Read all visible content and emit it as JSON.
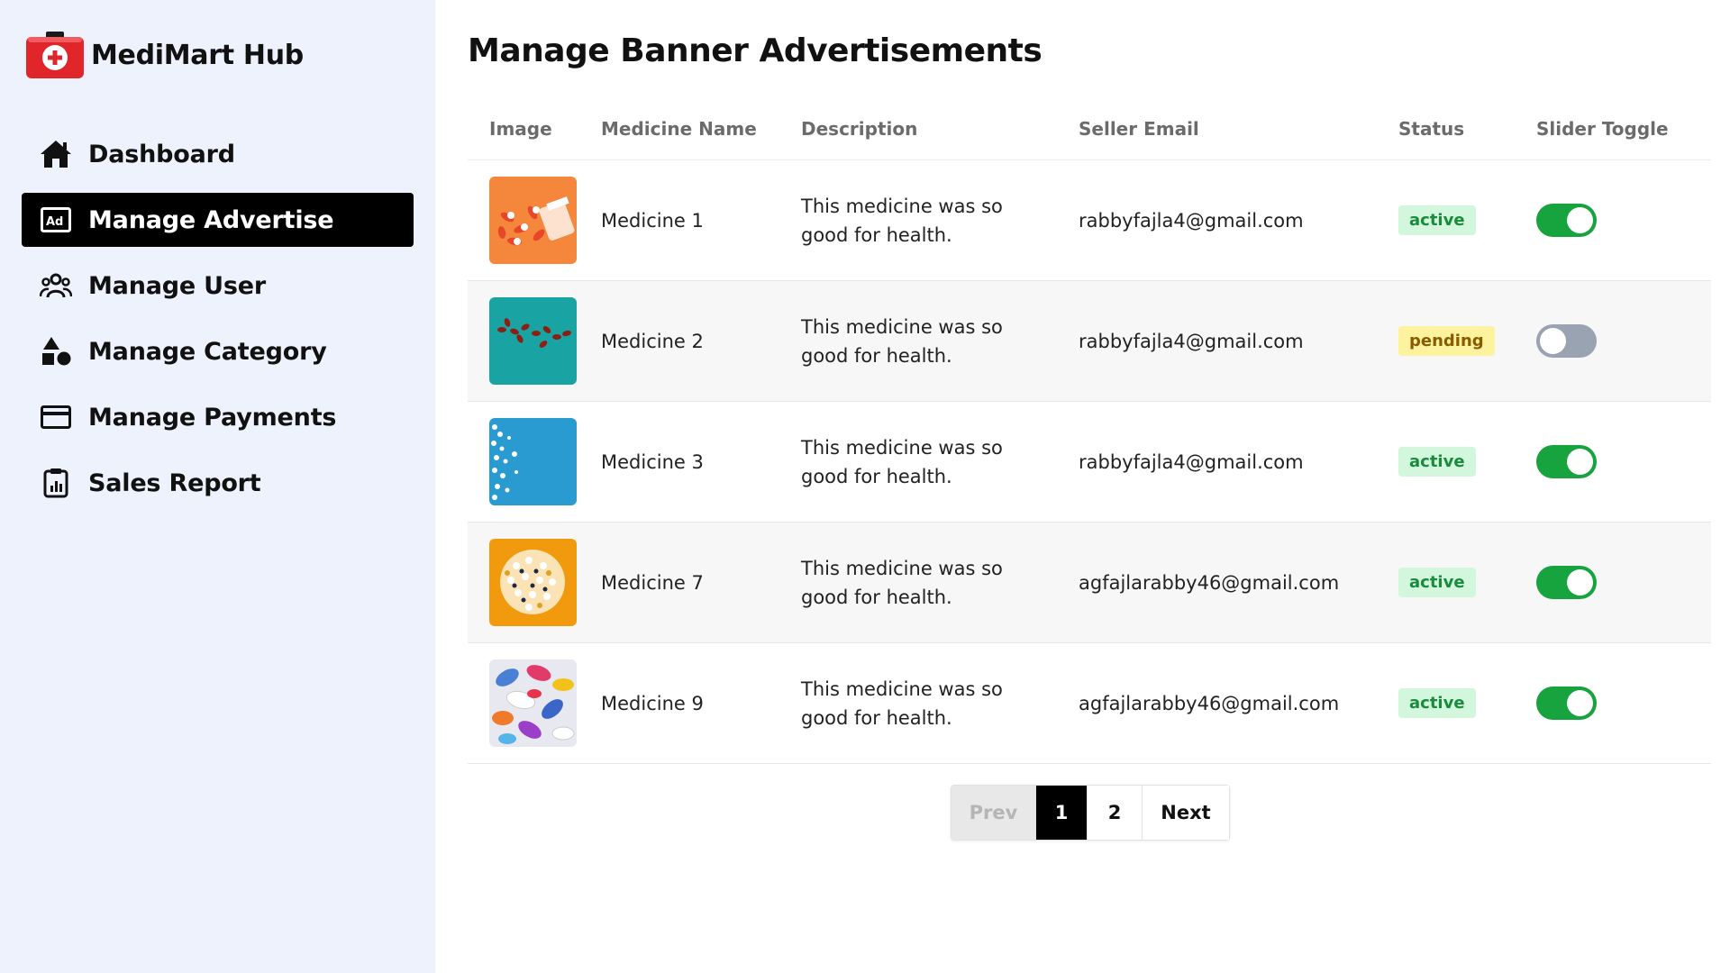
{
  "app": {
    "name": "MediMart Hub"
  },
  "sidebar": {
    "items": [
      {
        "label": "Dashboard",
        "icon": "home-icon"
      },
      {
        "label": "Manage Advertise",
        "icon": "ad-icon",
        "active": true
      },
      {
        "label": "Manage User",
        "icon": "users-icon"
      },
      {
        "label": "Manage Category",
        "icon": "shapes-icon"
      },
      {
        "label": "Manage Payments",
        "icon": "credit-card-icon"
      },
      {
        "label": "Sales Report",
        "icon": "clipboard-report-icon"
      }
    ]
  },
  "page": {
    "title": "Manage Banner Advertisements"
  },
  "table": {
    "headers": {
      "image": "Image",
      "name": "Medicine Name",
      "description": "Description",
      "email": "Seller Email",
      "status": "Status",
      "toggle": "Slider Toggle"
    },
    "rows": [
      {
        "name": "Medicine 1",
        "description": "This medicine was so good for health.",
        "email": "rabbyfajla4@gmail.com",
        "status": "active",
        "slider_on": true,
        "image": "orange-pills-bottle"
      },
      {
        "name": "Medicine 2",
        "description": "This medicine was so good for health.",
        "email": "rabbyfajla4@gmail.com",
        "status": "pending",
        "slider_on": false,
        "image": "teal-red-capsules"
      },
      {
        "name": "Medicine 3",
        "description": "This medicine was so good for health.",
        "email": "rabbyfajla4@gmail.com",
        "status": "active",
        "slider_on": true,
        "image": "blue-white-pills"
      },
      {
        "name": "Medicine 7",
        "description": "This medicine was so good for health.",
        "email": "agfajlarabby46@gmail.com",
        "status": "active",
        "slider_on": true,
        "image": "yellow-mixed-pills"
      },
      {
        "name": "Medicine 9",
        "description": "This medicine was so good for health.",
        "email": "agfajlarabby46@gmail.com",
        "status": "active",
        "slider_on": true,
        "image": "colorful-pills-pile"
      }
    ]
  },
  "pagination": {
    "prev": "Prev",
    "pages": [
      "1",
      "2"
    ],
    "current": "1",
    "next": "Next"
  },
  "colors": {
    "sidebar_bg": "#eef2fd",
    "active_nav": "#000000",
    "toggle_on": "#17a33d",
    "toggle_off": "#9aa3b2",
    "active_badge_bg": "#d2f7dc",
    "pending_badge_bg": "#fdf39e",
    "logo_red": "#e0262b"
  }
}
